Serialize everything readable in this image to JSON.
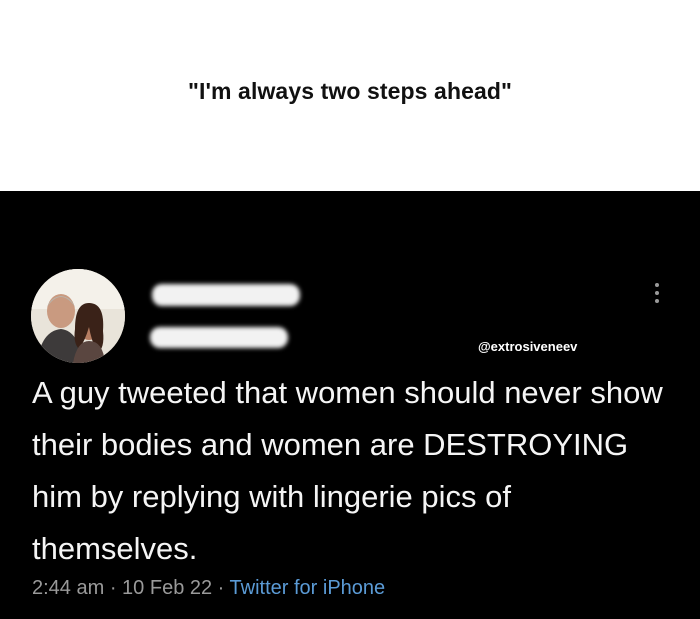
{
  "caption": "\"I'm always two steps ahead\"",
  "tweet": {
    "watermark": "@extrosiveneev",
    "text": "A guy tweeted that women should never show their bodies and women are DESTROYING him by replying with lingerie pics of themselves.",
    "time": "2:44 am",
    "separator": " · ",
    "date": "10 Feb 22",
    "source": "Twitter for iPhone"
  },
  "icons": [
    "avatar-photo",
    "more-options-icon"
  ],
  "colors": {
    "background": "#000000",
    "text": "#f5f5f5",
    "meta": "#9a9a9a",
    "link": "#5b9bd6"
  }
}
